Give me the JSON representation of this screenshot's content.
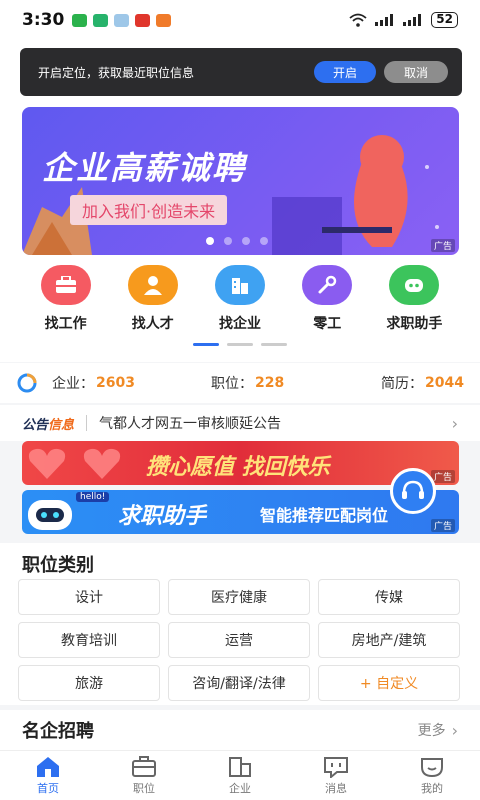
{
  "status_bar": {
    "time": "3:30",
    "battery": "52"
  },
  "location_prompt": {
    "message": "开启定位，获取最近职位信息",
    "open_label": "开启",
    "cancel_label": "取消"
  },
  "banner": {
    "title": "企业高薪诚聘",
    "subtitle": "加入我们·创造未来",
    "ad_label": "广告"
  },
  "quick_links": [
    {
      "label": "找工作",
      "color": "#f55a62",
      "icon": "briefcase-icon"
    },
    {
      "label": "找人才",
      "color": "#f79a1d",
      "icon": "person-icon"
    },
    {
      "label": "找企业",
      "color": "#3fa2f2",
      "icon": "building-icon"
    },
    {
      "label": "零工",
      "color": "#8a5cf0",
      "icon": "wrench-icon"
    },
    {
      "label": "求职助手",
      "color": "#3cc45c",
      "icon": "robot-icon"
    }
  ],
  "stats": {
    "company_label": "企业：",
    "company_value": "2603",
    "job_label": "职位：",
    "job_value": "228",
    "resume_label": "简历：",
    "resume_value": "2044"
  },
  "notice": {
    "tag_a": "公告",
    "tag_b": "信息",
    "text": "气都人才网五一审核顺延公告"
  },
  "ads": [
    {
      "text": "攒心愿值 找回快乐",
      "ad_label": "广告"
    },
    {
      "text": "求职助手",
      "sub": "智能推荐匹配岗位",
      "badge": "hello!",
      "ad_label": "广告"
    }
  ],
  "categories": {
    "title": "职位类别",
    "items": [
      "设计",
      "医疗健康",
      "传媒",
      "教育培训",
      "运营",
      "房地产/建筑",
      "旅游",
      "咨询/翻译/法律",
      "+ 自定义"
    ]
  },
  "famous": {
    "title": "名企招聘",
    "more": "更多"
  },
  "bottom_nav": [
    {
      "label": "首页",
      "icon": "home-icon",
      "active": true
    },
    {
      "label": "职位",
      "icon": "briefcase-icon",
      "active": false
    },
    {
      "label": "企业",
      "icon": "building-icon",
      "active": false
    },
    {
      "label": "消息",
      "icon": "message-icon",
      "active": false
    },
    {
      "label": "我的",
      "icon": "profile-icon",
      "active": false
    }
  ]
}
